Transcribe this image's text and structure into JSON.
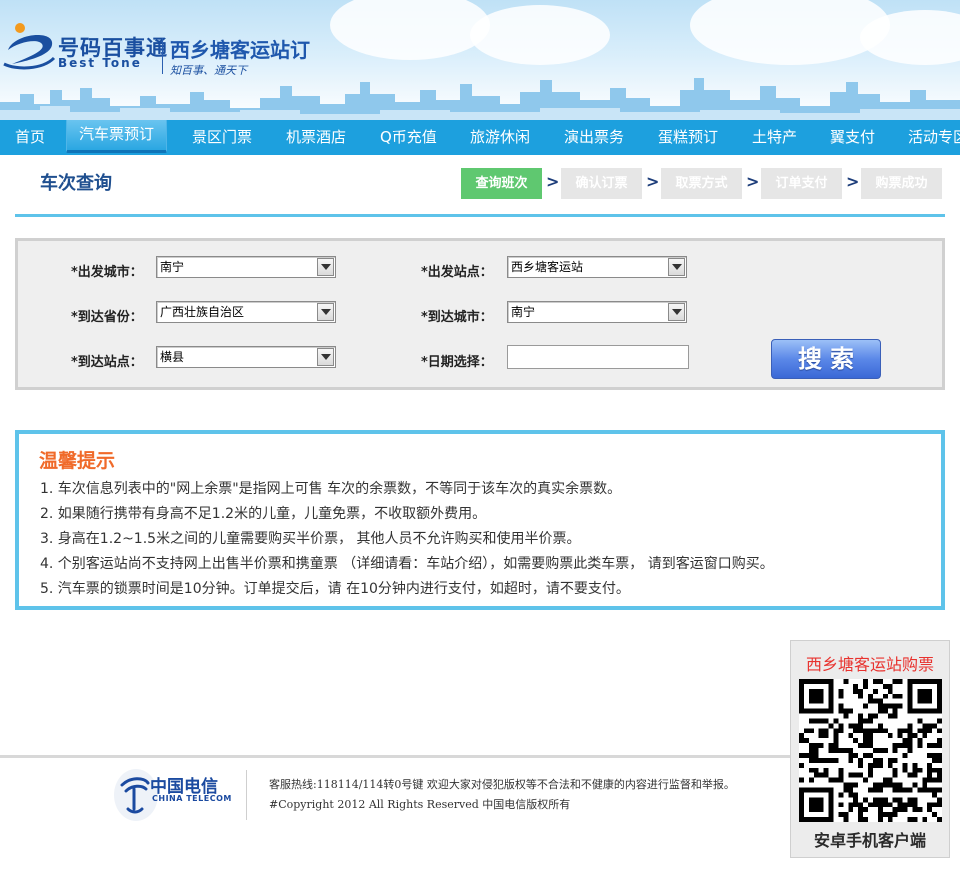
{
  "brand": {
    "name_cn": "号码百事通",
    "name_en": "Best Tone",
    "site_title": "西乡塘客运站订",
    "slogan": "知百事、通天下"
  },
  "nav": {
    "items": [
      {
        "label": "首页"
      },
      {
        "label": "汽车票预订",
        "active": true
      },
      {
        "label": "景区门票"
      },
      {
        "label": "机票酒店"
      },
      {
        "label": "Q币充值"
      },
      {
        "label": "旅游休闲"
      },
      {
        "label": "演出票务"
      },
      {
        "label": "蛋糕预订"
      },
      {
        "label": "土特产"
      },
      {
        "label": "翼支付"
      },
      {
        "label": "活动专区"
      }
    ]
  },
  "page": {
    "title": "车次查询"
  },
  "steps": {
    "items": [
      {
        "label": "查询班次",
        "active": true
      },
      {
        "label": "确认订票"
      },
      {
        "label": "取票方式"
      },
      {
        "label": "订单支付"
      },
      {
        "label": "购票成功"
      }
    ],
    "separator": ">"
  },
  "form": {
    "depart_city": {
      "label": "*出发城市：",
      "value": "南宁"
    },
    "depart_station": {
      "label": "*出发站点：",
      "value": "西乡塘客运站"
    },
    "arrive_province": {
      "label": "*到达省份：",
      "value": "广西壮族自治区"
    },
    "arrive_city": {
      "label": "*到达城市：",
      "value": "南宁"
    },
    "arrive_station": {
      "label": "*到达站点：",
      "value": "横县"
    },
    "date": {
      "label": "*日期选择：",
      "value": "",
      "placeholder": ""
    },
    "search_label": "搜索"
  },
  "tips": {
    "title": "温馨提示",
    "items": [
      "1. 车次信息列表中的\"网上余票\"是指网上可售 车次的余票数，不等同于该车次的真实余票数。",
      "2. 如果随行携带有身高不足1.2米的儿童，儿童免票，不收取额外费用。",
      "3. 身高在1.2~1.5米之间的儿童需要购买半价票， 其他人员不允许购买和使用半价票。",
      "4. 个别客运站尚不支持网上出售半价票和携童票 （详细请看：车站介绍），如需要购票此类车票， 请到客运窗口购买。",
      "5. 汽车票的锁票时间是10分钟。订单提交后，请 在10分钟内进行支付，如超时，请不要支付。"
    ]
  },
  "side_qr": {
    "title": "西乡塘客运站购票",
    "caption": "安卓手机客户端"
  },
  "footer": {
    "logo_cn": "中国电信",
    "logo_en": "CHINA TELECOM",
    "line1": "客服热线:118114/114转0号键   欢迎大家对侵犯版权等不合法和不健康的内容进行监督和举报。",
    "line2": "#Copyright 2012 All Rights Reserved 中国电信版权所有"
  },
  "colors": {
    "nav_bg": "#1da0de",
    "step_active": "#5fc870",
    "step_inactive": "#e6e6e6",
    "accent_rule": "#5ec3ea",
    "tips_title": "#f06a2a",
    "qr_title": "#e8322e",
    "search_button": "#4a78e0"
  }
}
